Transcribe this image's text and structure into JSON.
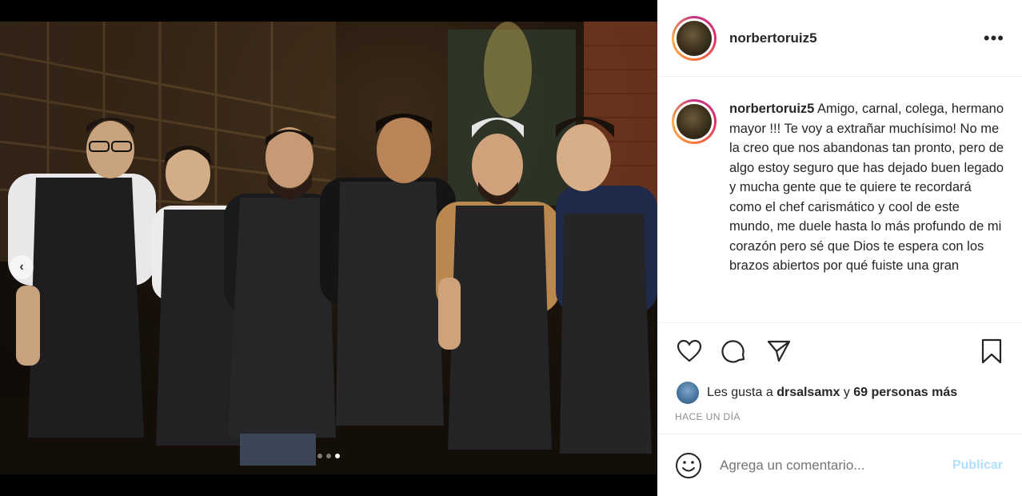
{
  "post": {
    "username": "norbertoruiz5",
    "more_icon": "more-horizontal-icon",
    "caption": {
      "username": "norbertoruiz5",
      "text": "Amigo, carnal, colega, hermano mayor !!! Te voy a extrañar muchísimo! No me la creo que nos abandonas tan pronto, pero de algo estoy seguro que has dejado buen legado y mucha gente que te quiere te recordará como el chef carismático y cool de este mundo, me duele hasta lo más profundo de mi corazón pero sé que Dios te espera con los brazos abiertos por qué fuiste una gran"
    },
    "carousel": {
      "count": 3,
      "active_index": 2,
      "prev_icon": "chevron-left-icon"
    },
    "actions": [
      "heart-icon",
      "comment-icon",
      "share-icon",
      "bookmark-icon"
    ],
    "likes": {
      "prefix": "Les gusta a",
      "user": "drsalsamx",
      "conj": "y",
      "others": "69 personas más"
    },
    "timestamp": "HACE UN DÍA",
    "comment": {
      "placeholder": "Agrega un comentario...",
      "publish_label": "Publicar",
      "emoji_icon": "emoji-icon"
    },
    "colors": {
      "publish_disabled": "#b2dffc",
      "secondary_text": "#8e8e8e",
      "border": "#efefef"
    }
  }
}
